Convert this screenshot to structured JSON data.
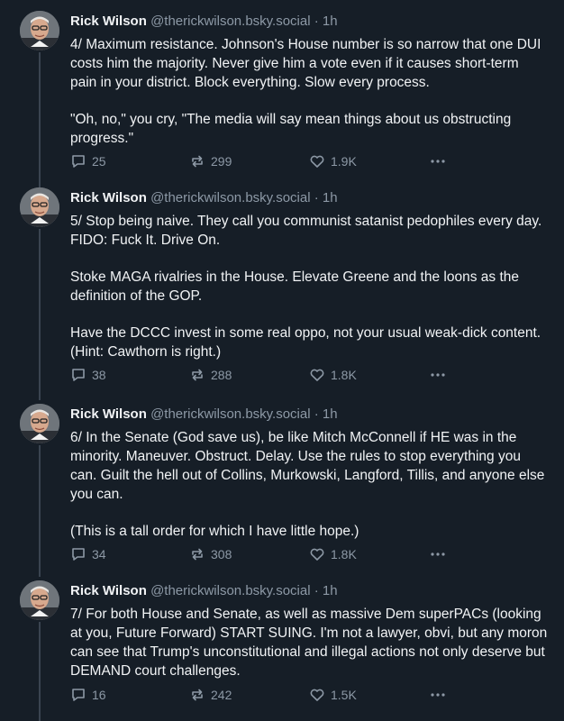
{
  "posts": [
    {
      "author": "Rick Wilson",
      "handle": "@therickwilson.bsky.social",
      "separator": "·",
      "time": "1h",
      "paragraphs": [
        "4/ Maximum resistance. Johnson's House number is so narrow that one DUI costs him the majority. Never give him a vote even if it causes short-term pain in your district. Block everything. Slow every process.",
        "\"Oh, no,\" you cry, \"The media will say mean things about us obstructing progress.\""
      ],
      "replies": "25",
      "reposts": "299",
      "likes": "1.9K"
    },
    {
      "author": "Rick Wilson",
      "handle": "@therickwilson.bsky.social",
      "separator": "·",
      "time": "1h",
      "paragraphs": [
        "5/ Stop being naive. They call you communist satanist pedophiles every day. FIDO: Fuck It. Drive On.",
        "Stoke MAGA rivalries in the House. Elevate Greene and the loons as the definition of the GOP.",
        "Have the DCCC invest in some real oppo, not your usual weak-dick content. (Hint: Cawthorn is right.)"
      ],
      "replies": "38",
      "reposts": "288",
      "likes": "1.8K"
    },
    {
      "author": "Rick Wilson",
      "handle": "@therickwilson.bsky.social",
      "separator": "·",
      "time": "1h",
      "paragraphs": [
        "6/ In the Senate (God save us), be like Mitch McConnell if HE was in the minority. Maneuver. Obstruct. Delay. Use the rules to stop everything you can. Guilt the hell out of Collins, Murkowski, Langford, Tillis, and anyone else you can.",
        "(This is a tall order for which I have little hope.)"
      ],
      "replies": "34",
      "reposts": "308",
      "likes": "1.8K"
    },
    {
      "author": "Rick Wilson",
      "handle": "@therickwilson.bsky.social",
      "separator": "·",
      "time": "1h",
      "paragraphs": [
        "7/ For both House and Senate, as well as massive Dem superPACs (looking at you, Future Forward) START SUING. I'm not a lawyer, obvi, but any moron can see that Trump's unconstitutional and illegal actions not only deserve but DEMAND court challenges."
      ],
      "replies": "16",
      "reposts": "242",
      "likes": "1.5K"
    }
  ],
  "icons": {
    "reply": "reply-icon",
    "repost": "repost-icon",
    "like": "heart-icon",
    "more": "more-options-icon"
  },
  "colors": {
    "background": "#161e27",
    "text": "#f1f3f5",
    "muted": "#8d99a6",
    "thread_line": "#3a4450"
  }
}
